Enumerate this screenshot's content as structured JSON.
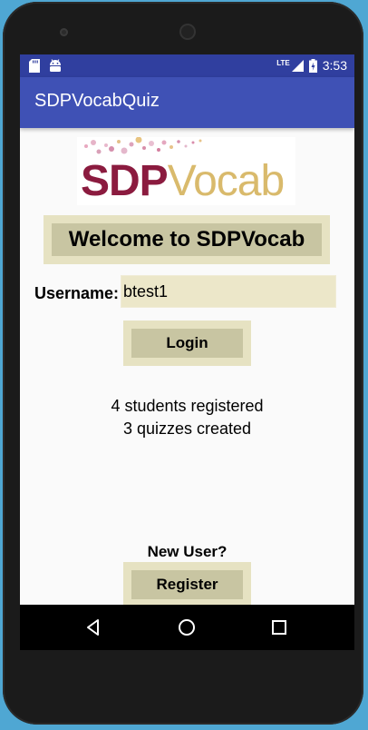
{
  "status_bar": {
    "left_icons": [
      "sd-card-icon",
      "android-icon"
    ],
    "network": "LTE",
    "time": "3:53"
  },
  "app_bar": {
    "title": "SDPVocabQuiz"
  },
  "logo": {
    "part1": "SDP",
    "part2": "Vocab"
  },
  "welcome": {
    "text": "Welcome to SDPVocab"
  },
  "login_form": {
    "username_label": "Username:",
    "username_value": "btest1",
    "login_label": "Login"
  },
  "stats": {
    "students": "4 students registered",
    "quizzes": "3 quizzes created"
  },
  "register": {
    "prompt": "New User?",
    "button_label": "Register"
  },
  "nav": {
    "back": "back-icon",
    "home": "home-icon",
    "recents": "recents-icon"
  },
  "colors": {
    "status_bar": "#303f9f",
    "app_bar": "#3f51b5",
    "button_outer": "#e6e2c2",
    "button_inner": "#c8c5a2",
    "logo_maroon": "#8b1b3f",
    "logo_gold": "#d9ba6c"
  }
}
